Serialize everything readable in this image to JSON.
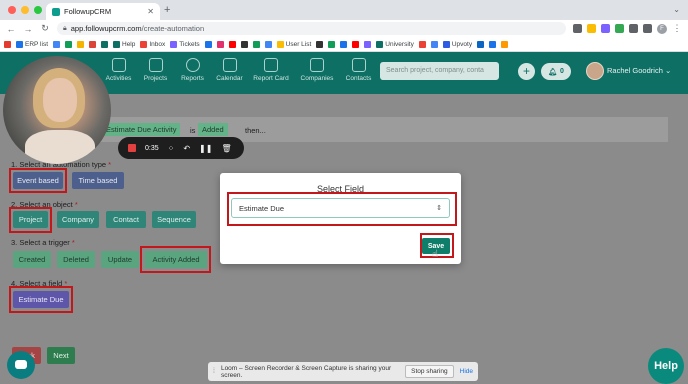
{
  "browser": {
    "tab_title": "FollowupCRM",
    "url_host": "app.followupcrm.com",
    "url_path": "/create-automation",
    "profile_initial": "F",
    "bookmarks": [
      "ERP list",
      "Help",
      "Inbox",
      "Tickets",
      "User List",
      "University",
      "Upvoty"
    ]
  },
  "header": {
    "nav": [
      {
        "label": "Activities",
        "icon": "activities-icon"
      },
      {
        "label": "Projects",
        "icon": "folder-icon"
      },
      {
        "label": "Reports",
        "icon": "reports-icon"
      },
      {
        "label": "Calendar",
        "icon": "calendar-icon"
      },
      {
        "label": "Report Card",
        "icon": "report-card-icon"
      },
      {
        "label": "Companies",
        "icon": "companies-icon"
      },
      {
        "label": "Contacts",
        "icon": "contacts-icon"
      }
    ],
    "search_placeholder": "Search project, company, conta",
    "notification_count": "0",
    "user_name": "Rachel Goodrich"
  },
  "summary": {
    "field_chip": "Estimate Due Activity",
    "is_text": "is",
    "value_chip": "Added",
    "then_text": "then..."
  },
  "recorder": {
    "time": "0:35"
  },
  "steps": {
    "s1_label": "1. Select an automation type",
    "s1_options": [
      "Event based",
      "Time based"
    ],
    "s2_label": "2. Select an object",
    "s2_options": [
      "Project",
      "Company",
      "Contact",
      "Sequence"
    ],
    "s3_label": "3. Select a trigger",
    "s3_options": [
      "Created",
      "Deleted",
      "Update",
      "Activity Added"
    ],
    "s4_label": "4. Select a field",
    "s4_value": "Estimate Due",
    "required_mark": "*",
    "back_label": "Back",
    "next_label": "Next"
  },
  "modal": {
    "title": "Select Field",
    "selected_value": "Estimate Due",
    "save_label": "Save"
  },
  "share_bar": {
    "message": "Loom – Screen Recorder & Screen Capture is sharing your screen.",
    "stop_label": "Stop sharing",
    "hide_label": "Hide"
  },
  "help_label": "Help",
  "colors": {
    "brand": "#0e6f64",
    "highlight_border": "#c2171b",
    "selected_step": "#4d5f8c"
  }
}
